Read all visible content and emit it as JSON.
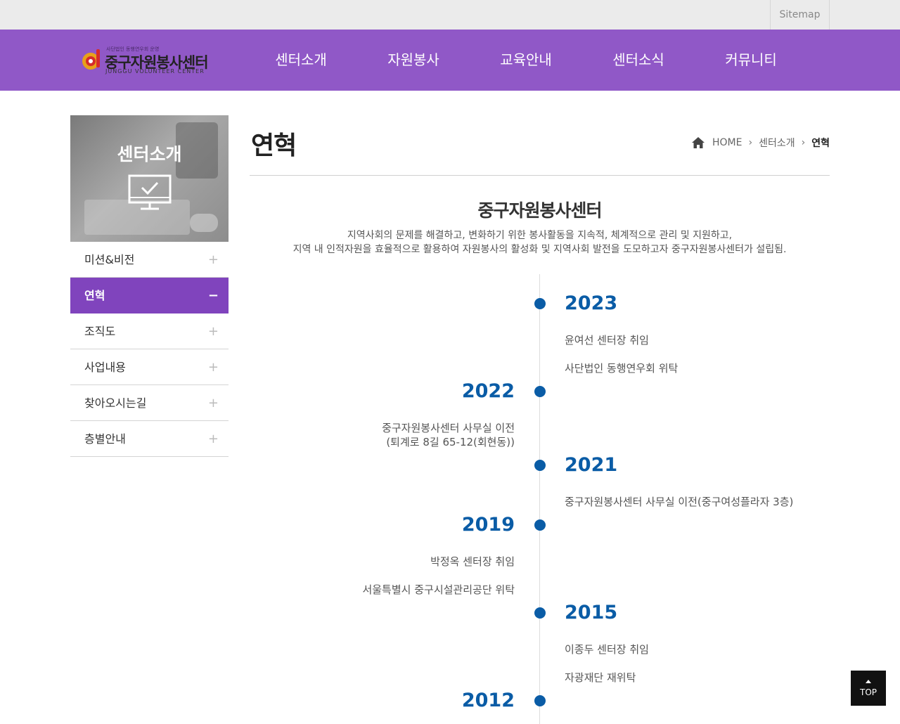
{
  "topbar": {
    "sitemap_label": "Sitemap"
  },
  "logo": {
    "small_text": "사단법인 동행연우회 운영",
    "title": "중구자원봉사센터",
    "english": "JUNGGU VOLUNTEER CENTER"
  },
  "nav": {
    "items": [
      "센터소개",
      "자원봉사",
      "교육안내",
      "센터소식",
      "커뮤니티"
    ]
  },
  "sidebar": {
    "title": "센터소개",
    "items": [
      {
        "label": "미션&비전",
        "marker": "+"
      },
      {
        "label": "연혁",
        "marker": "−"
      },
      {
        "label": "조직도",
        "marker": "+"
      },
      {
        "label": "사업내용",
        "marker": "+"
      },
      {
        "label": "찾아오시는길",
        "marker": "+"
      },
      {
        "label": "층별안내",
        "marker": "+"
      }
    ],
    "active_index": 1
  },
  "page": {
    "title": "연혁",
    "breadcrumb": {
      "home": "HOME",
      "section": "센터소개",
      "current": "연혁"
    }
  },
  "intro": {
    "title": "중구자원봉사센터",
    "line1": "지역사회의 문제를 해결하고, 변화하기 위한 봉사활동을 지속적, 체계적으로 관리 및 지원하고,",
    "line2": "지역 내 인적자원을 효율적으로 활용하여 자원봉사의 활성화 및 지역사회 발전을 도모하고자 중구자원봉사센터가 설립됨."
  },
  "timeline": [
    {
      "year": "2023",
      "side": "right",
      "items": [
        "윤여선 센터장 취임",
        "사단법인 동행연우회 위탁"
      ]
    },
    {
      "year": "2022",
      "side": "left",
      "items": [
        "중구자원봉사센터 사무실 이전",
        "(퇴계로 8길 65-12(회현동))"
      ]
    },
    {
      "year": "2021",
      "side": "right",
      "items": [
        "중구자원봉사센터 사무실 이전(중구여성플라자 3층)"
      ]
    },
    {
      "year": "2019",
      "side": "left",
      "items": [
        "박정옥 센터장 취임",
        "서울특별시 중구시설관리공단 위탁"
      ]
    },
    {
      "year": "2015",
      "side": "right",
      "items": [
        "이종두 센터장 취임",
        "자광재단 재위탁"
      ]
    },
    {
      "year": "2012",
      "side": "left",
      "items": []
    }
  ],
  "top_button": {
    "label": "TOP"
  },
  "colors": {
    "gnb": "#9058c7",
    "active_menu": "#8044bd",
    "timeline_accent": "#0a5ca6"
  },
  "icons": [
    "home-icon",
    "chevron-right-icon",
    "monitor-check-icon",
    "plus-icon",
    "minus-icon",
    "arrow-up-icon"
  ]
}
